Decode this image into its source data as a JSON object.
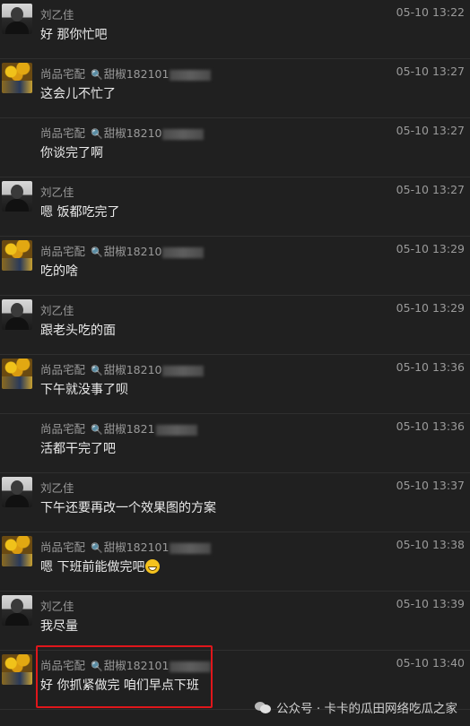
{
  "messages": [
    {
      "sender": "刘乙佳",
      "avatar": "person",
      "time": "05-10 13:22",
      "text": "好 那你忙吧",
      "tagged": false,
      "show_avatar": true
    },
    {
      "sender": "尚品宅配",
      "tag": "甜椒182101",
      "avatar": "flower",
      "time": "05-10 13:27",
      "text": "这会儿不忙了",
      "tagged": true,
      "show_avatar": true
    },
    {
      "sender": "尚品宅配",
      "tag": "甜椒18210",
      "avatar": "flower",
      "time": "05-10 13:27",
      "text": "你谈完了啊",
      "tagged": true,
      "show_avatar": false
    },
    {
      "sender": "刘乙佳",
      "avatar": "person",
      "time": "05-10 13:27",
      "text": "嗯 饭都吃完了",
      "tagged": false,
      "show_avatar": true
    },
    {
      "sender": "尚品宅配",
      "tag": "甜椒18210",
      "avatar": "flower",
      "time": "05-10 13:29",
      "text": "吃的啥",
      "tagged": true,
      "show_avatar": true
    },
    {
      "sender": "刘乙佳",
      "avatar": "person",
      "time": "05-10 13:29",
      "text": "跟老头吃的面",
      "tagged": false,
      "show_avatar": true
    },
    {
      "sender": "尚品宅配",
      "tag": "甜椒18210",
      "avatar": "flower",
      "time": "05-10 13:36",
      "text": "下午就没事了呗",
      "tagged": true,
      "show_avatar": true
    },
    {
      "sender": "尚品宅配",
      "tag": "甜椒1821",
      "avatar": "flower",
      "time": "05-10 13:36",
      "text": "活都干完了吧",
      "tagged": true,
      "show_avatar": false
    },
    {
      "sender": "刘乙佳",
      "avatar": "person",
      "time": "05-10 13:37",
      "text": "下午还要再改一个效果图的方案",
      "tagged": false,
      "show_avatar": true
    },
    {
      "sender": "尚品宅配",
      "tag": "甜椒182101",
      "avatar": "flower",
      "time": "05-10 13:38",
      "text": "嗯 下班前能做完吧",
      "emoji": "grin-emoji",
      "tagged": true,
      "show_avatar": true
    },
    {
      "sender": "刘乙佳",
      "avatar": "person",
      "time": "05-10 13:39",
      "text": "我尽量",
      "tagged": false,
      "show_avatar": true
    },
    {
      "sender": "尚品宅配",
      "tag": "甜椒182101",
      "avatar": "flower",
      "time": "05-10 13:40",
      "text": "好 你抓紧做完 咱们早点下班",
      "tagged": true,
      "show_avatar": true
    }
  ],
  "highlight_color": "#e0161b",
  "watermark": {
    "text": "公众号 · 卡卡的瓜田网络吃瓜之家",
    "icon": "wechat-icon"
  }
}
